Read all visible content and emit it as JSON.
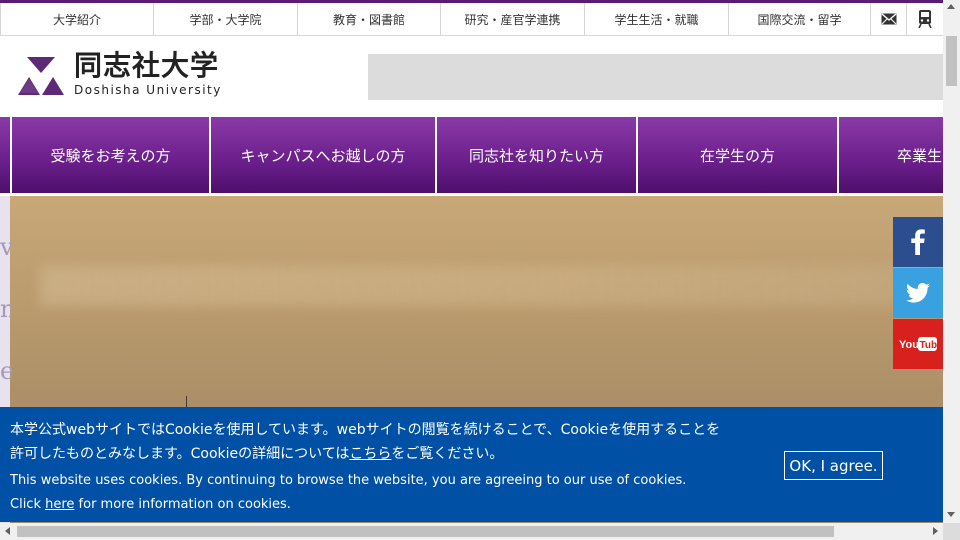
{
  "topnav": {
    "items": [
      "大学紹介",
      "学部・大学院",
      "教育・図書館",
      "研究・産官学連携",
      "学生生活・就職",
      "国際交流・留学"
    ],
    "icons": [
      "mail-icon",
      "train-icon"
    ]
  },
  "header": {
    "logo_jp": "同志社大学",
    "logo_en": "Doshisha University"
  },
  "mainnav": {
    "items": [
      "受験をお考えの方",
      "キャンパスへお越しの方",
      "同志社を知りたい方",
      "在学生の方",
      "卒業生"
    ]
  },
  "hero": {
    "side_letters": [
      "v",
      "n",
      "e"
    ]
  },
  "social": [
    "facebook-icon",
    "twitter-icon",
    "youtube-icon"
  ],
  "cookie": {
    "jp_line1": "本学公式webサイトではCookieを使用しています。webサイトの閲覧を続けることで、Cookieを使用することを",
    "jp_line2_before": "許可したものとみなします。Cookieの詳細については",
    "jp_link": "こちら",
    "jp_line2_after": "をご覧ください。",
    "en_line1": "This website uses cookies. By continuing to browse the website, you are agreeing to our use of cookies.",
    "en_line2_before": "Click ",
    "en_link": "here",
    "en_line2_after": " for more information on cookies.",
    "ok_label": "OK, I agree."
  },
  "colors": {
    "brand_purple": "#6a1e8a",
    "cookie_blue": "#0051a6",
    "facebook": "#2d4e8e",
    "twitter": "#3aa1e0",
    "youtube": "#d8201c"
  }
}
